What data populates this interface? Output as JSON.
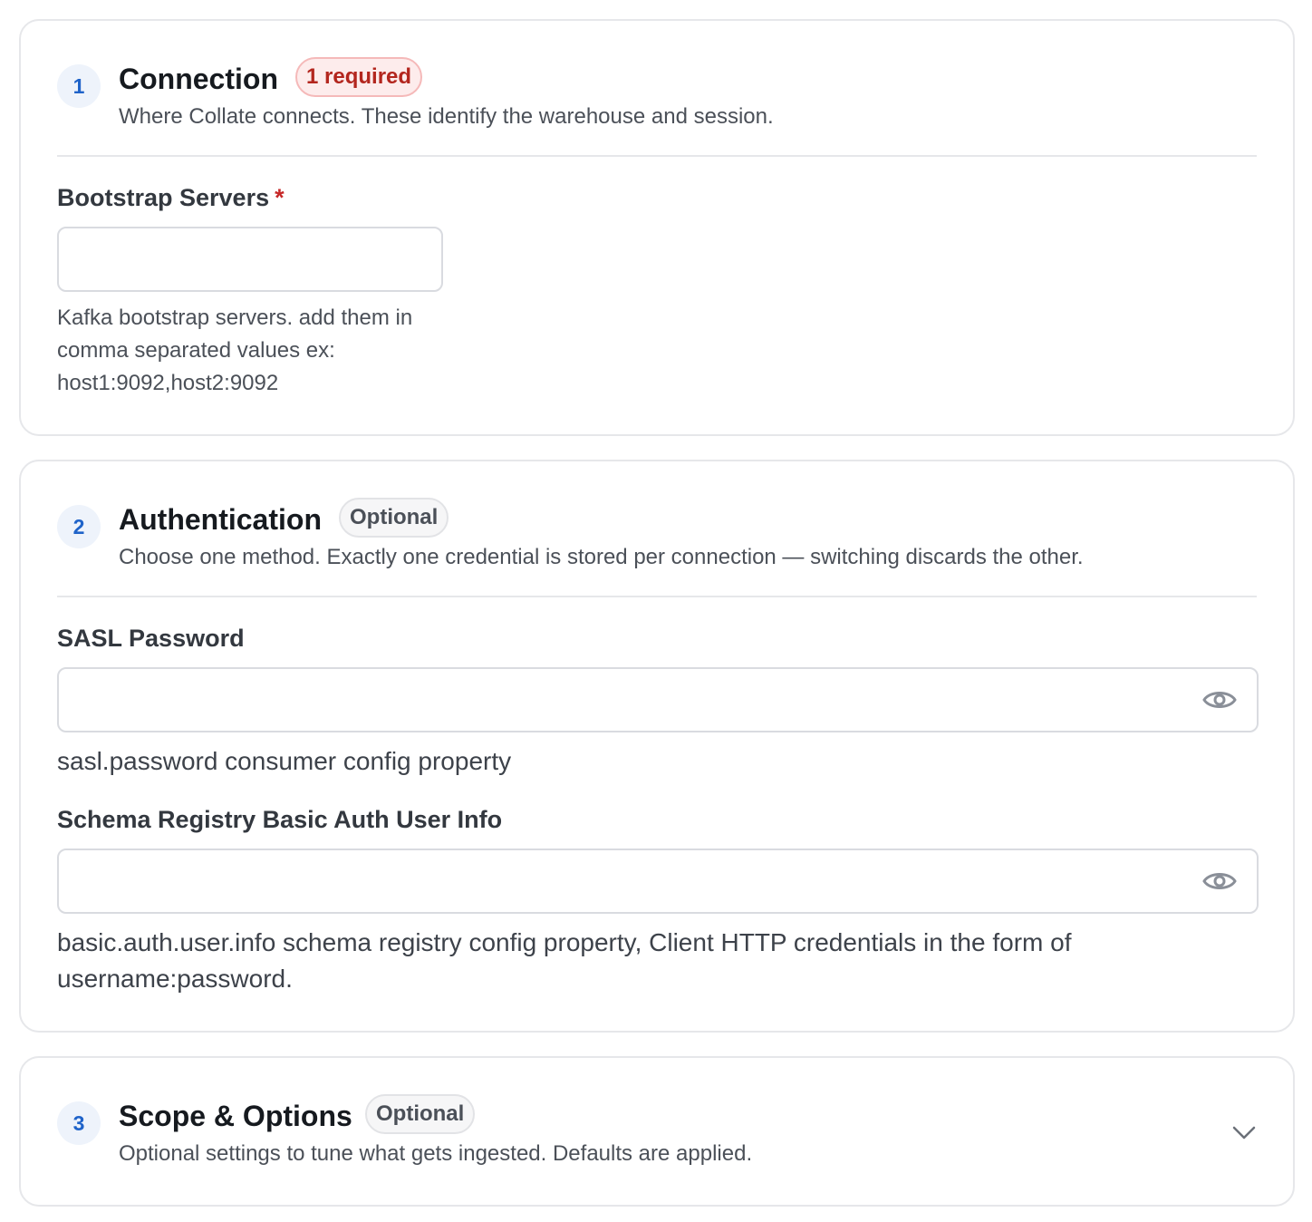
{
  "sections": [
    {
      "number": "1",
      "title": "Connection",
      "badge": "1 required",
      "subtitle": "Where Collate connects. These identify the warehouse and session.",
      "fields": [
        {
          "label": "Bootstrap Servers",
          "required_marker": "*",
          "value": "",
          "help": "Kafka bootstrap servers. add them in comma separated values ex: host1:9092,host2:9092"
        }
      ]
    },
    {
      "number": "2",
      "title": "Authentication",
      "badge": "Optional",
      "subtitle": "Choose one method. Exactly one credential is stored per connection — switching discards the other.",
      "fields": [
        {
          "label": "SASL Password",
          "value": "",
          "help": "sasl.password consumer config property",
          "icon": "eye-icon"
        },
        {
          "label": "Schema Registry Basic Auth User Info",
          "value": "",
          "help": "basic.auth.user.info schema registry config property, Client HTTP credentials in the form of username:password.",
          "icon": "eye-icon"
        }
      ]
    },
    {
      "number": "3",
      "title": "Scope & Options",
      "badge": "Optional",
      "subtitle": "Optional settings to tune what gets ingested. Defaults are applied.",
      "collapsed": true,
      "icon": "chevron-down-icon"
    }
  ],
  "colors": {
    "step_badge_bg": "#eef3fb",
    "step_badge_text": "#1f63c9",
    "required_badge_bg": "#fdecec",
    "required_text": "#b3261e",
    "optional_badge_bg": "#f6f6f7",
    "border": "#e6e7ea"
  }
}
